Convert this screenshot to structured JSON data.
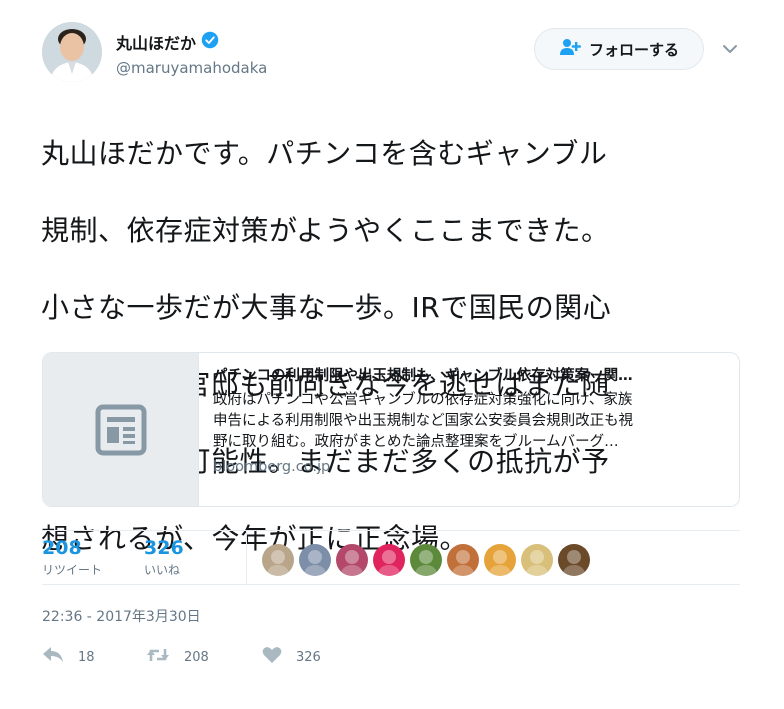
{
  "header": {
    "name": "丸山ほだか",
    "handle": "@maruyamahodaka",
    "follow_label": "フォローする"
  },
  "tweet": {
    "text_lines": [
      "丸山ほだかです。パチンコを含むギャンブル",
      "規制、依存症対策がようやくここまできた。",
      "小さな一歩だが大事な一歩。IRで国民の関心",
      "が高まり、官邸も前向きな今を逃せばまた随",
      "分先となる可能性。まだまだ多くの抵抗が予",
      "想されるが、今年が正に正念場。"
    ]
  },
  "card": {
    "title": "パチンコの利用制限や出玉規制も、ギャンブル依存対策案－関…",
    "desc_lines": [
      "政府はパチンコや公営ギャンブルの依存症対策強化に向け、家族",
      "申告による利用制限や出玉規制など国家公安委員会規則改正も視",
      "野に取り組む。政府がまとめた論点整理案をブルームバーグ…"
    ],
    "domain": "bloomberg.co.jp"
  },
  "stats": {
    "retweets": {
      "count": "208",
      "label": "リツイート"
    },
    "likes": {
      "count": "326",
      "label": "いいね"
    }
  },
  "likers": [
    {
      "name": "liker-1",
      "color": "#b9a58a"
    },
    {
      "name": "liker-2",
      "color": "#7c8ea8"
    },
    {
      "name": "liker-3",
      "color": "#b3486a"
    },
    {
      "name": "liker-4",
      "color": "#e0245e"
    },
    {
      "name": "liker-5",
      "color": "#5c8a3a"
    },
    {
      "name": "liker-6",
      "color": "#c2703a"
    },
    {
      "name": "liker-7",
      "color": "#e5a33a"
    },
    {
      "name": "liker-8",
      "color": "#d8c07a"
    },
    {
      "name": "liker-9",
      "color": "#6b4a2a"
    }
  ],
  "timestamp": "22:36 - 2017年3月30日",
  "actions": {
    "reply_count": "18",
    "retweet_count": "208",
    "like_count": "326"
  },
  "colors": {
    "accent": "#1da1f2",
    "link_count": "#1b95e0",
    "secondary_text": "#657786"
  }
}
